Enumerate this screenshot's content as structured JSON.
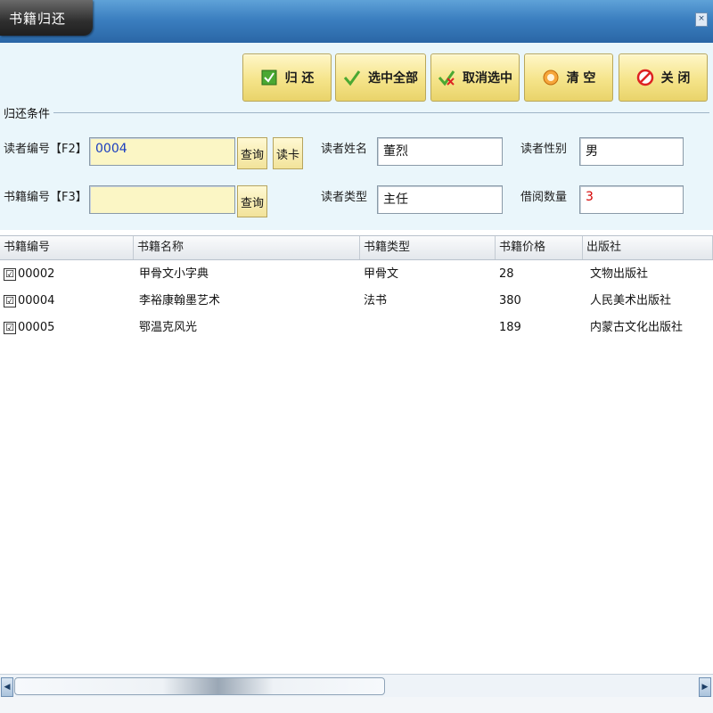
{
  "window": {
    "title": "书籍归还",
    "close_glyph": "×"
  },
  "toolbar": {
    "return_label": "归 还",
    "select_all_label": "选中全部",
    "deselect_label": "取消选中",
    "clear_label": "清 空",
    "close_label": "关 闭"
  },
  "form": {
    "group_title": "归还条件",
    "reader_id_label": "读者编号【F2】",
    "reader_id_value": "0004",
    "book_id_label": "书籍编号【F3】",
    "book_id_value": "",
    "query_label": "查询",
    "read_card_label": "读卡",
    "reader_name_label": "读者姓名",
    "reader_name_value": "董烈",
    "reader_gender_label": "读者性别",
    "reader_gender_value": "男",
    "reader_type_label": "读者类型",
    "reader_type_value": "主任",
    "borrow_count_label": "借阅数量",
    "borrow_count_value": "3"
  },
  "grid": {
    "columns": [
      "书籍编号",
      "书籍名称",
      "书籍类型",
      "书籍价格",
      "出版社"
    ],
    "rows": [
      {
        "checked": "☑",
        "id": "00002",
        "name": "甲骨文小字典",
        "type": "甲骨文",
        "price": "28",
        "publisher": "文物出版社"
      },
      {
        "checked": "☑",
        "id": "00004",
        "name": "李裕康翰墨艺术",
        "type": "法书",
        "price": "380",
        "publisher": "人民美术出版社"
      },
      {
        "checked": "☑",
        "id": "00005",
        "name": "鄂温克风光",
        "type": "",
        "price": "189",
        "publisher": "内蒙古文化出版社"
      }
    ]
  },
  "colors": {
    "accent_yellow": "#f5e48a",
    "titlebar_blue": "#3b7fc0",
    "panel_bg": "#eaf6fb",
    "count_red": "#d40000",
    "id_blue": "#1a3dbf"
  }
}
